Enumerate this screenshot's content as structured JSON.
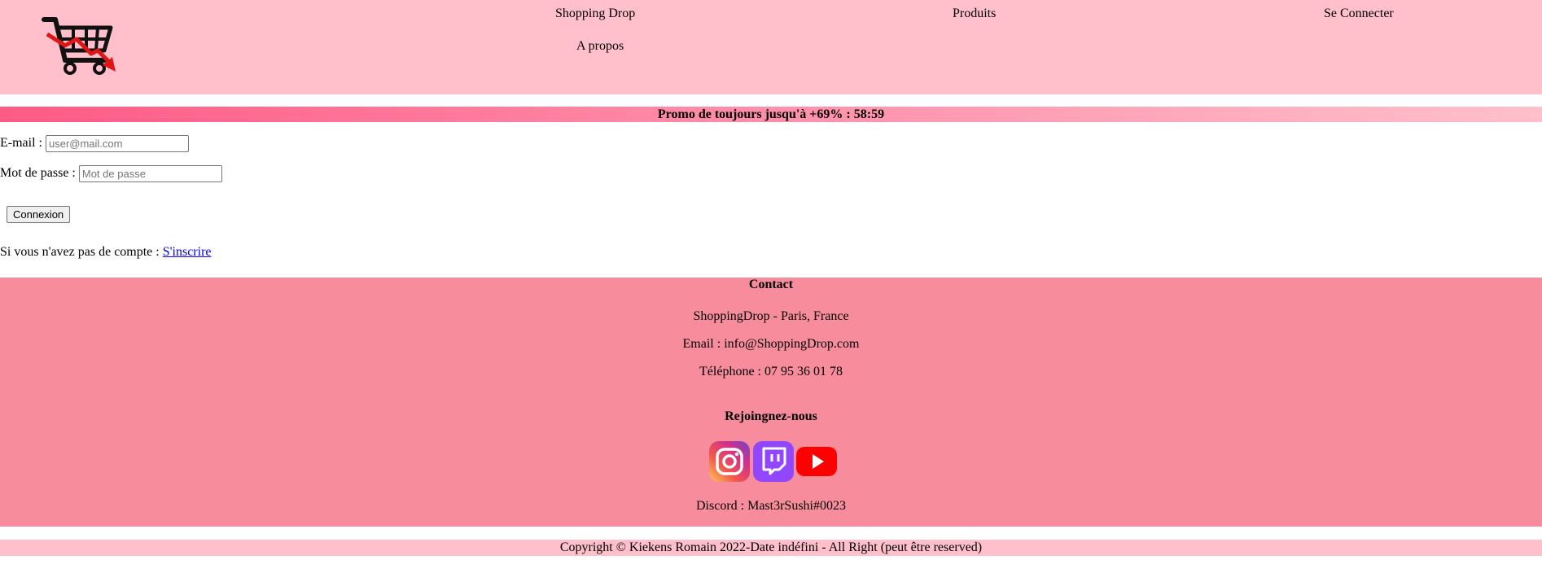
{
  "header": {
    "logo_icon": "shopping-cart-down-arrow-icon",
    "nav": {
      "shop": "Shopping Drop",
      "products": "Produits",
      "login": "Se Connecter",
      "about": "A propos"
    }
  },
  "promo": {
    "text": "Promo de toujours jusqu'à +69% : 58:59"
  },
  "login_form": {
    "email_label": "E-mail : ",
    "email_placeholder": "user@mail.com",
    "email_value": "",
    "password_label": "Mot de passe : ",
    "password_placeholder": "Mot de passe",
    "password_value": "",
    "submit_label": "Connexion",
    "signup_prompt": "Si vous n'avez pas de compte : ",
    "signup_link": "S'inscrire"
  },
  "contact": {
    "title": "Contact",
    "address": "ShoppingDrop - Paris, France",
    "email": "Email : info@ShoppingDrop.com",
    "phone": "Téléphone : 07 95 36 01 78",
    "join_title": "Rejoingnez-nous",
    "socials": [
      {
        "icon": "instagram-icon"
      },
      {
        "icon": "twitch-icon"
      },
      {
        "icon": "youtube-icon"
      }
    ],
    "discord": "Discord : Mast3rSushi#0023"
  },
  "footer": {
    "copyright": "Copyright © Kiekens Romain 2022-Date indéfini - All Right (peut être reserved)"
  },
  "colors": {
    "header_bg": "#ffc0cb",
    "contact_bg": "#f78d9c",
    "promo_start": "#ff5a86",
    "promo_end": "#ffc0cb",
    "link": "#0000ee"
  }
}
